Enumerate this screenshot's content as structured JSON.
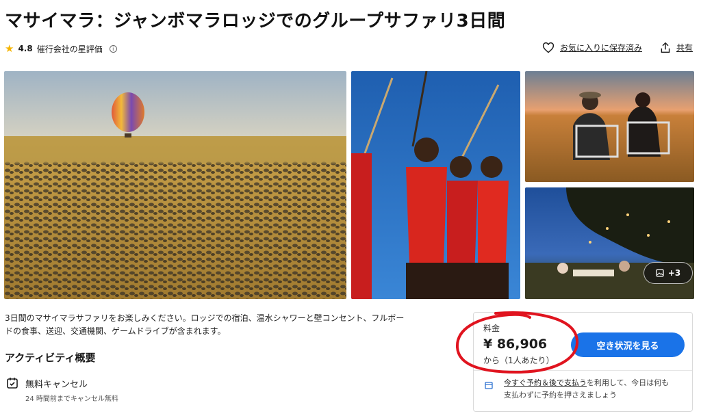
{
  "header": {
    "title": "マサイマラ：ジャンボマラロッジでのグループサファリ3日間",
    "rating_value": "4.8",
    "rating_label": "催行会社の星評価",
    "save_label": "お気に入りに保存済み",
    "share_label": "共有"
  },
  "gallery": {
    "more_label": "+3"
  },
  "description": {
    "line1": "3日間のマサイマラサファリをお楽しみください。ロッジでの宿泊、温水シャワーと壁コンセント、フルボー",
    "line2": "ドの食事、送迎、交通機関、ゲームドライブが含まれます。"
  },
  "overview": {
    "title": "アクティビティ概要",
    "cancel_title": "無料キャンセル",
    "cancel_sub": "24 時間前までキャンセル無料"
  },
  "price_card": {
    "label": "料金",
    "price": "¥ 86,906",
    "unit": "から（1人あたり）",
    "cta_label": "空き状況を見る",
    "note_link": "今すぐ予約＆後で支払う",
    "note_rest1": "を利用して、今日は何も",
    "note_rest2": "支払わずに予約を押さえましょう"
  },
  "colors": {
    "accent": "#1a73e8",
    "star": "#f5b400",
    "annotation": "#e0141f"
  }
}
